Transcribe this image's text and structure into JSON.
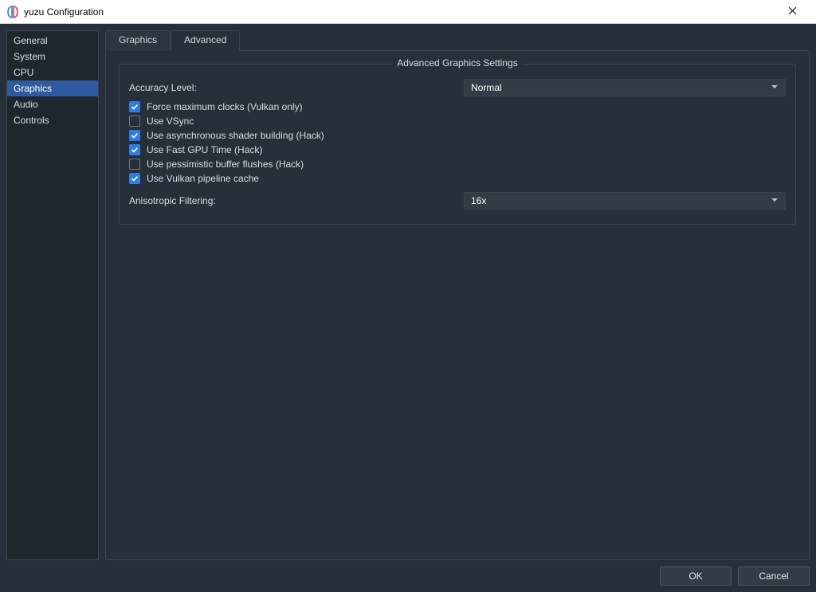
{
  "window": {
    "title": "yuzu Configuration"
  },
  "sidebar": {
    "items": [
      {
        "label": "General"
      },
      {
        "label": "System"
      },
      {
        "label": "CPU"
      },
      {
        "label": "Graphics"
      },
      {
        "label": "Audio"
      },
      {
        "label": "Controls"
      }
    ],
    "active_index": 3
  },
  "tabs": {
    "items": [
      {
        "label": "Graphics"
      },
      {
        "label": "Advanced"
      }
    ],
    "active_index": 1
  },
  "group": {
    "title": "Advanced Graphics Settings",
    "accuracy": {
      "label": "Accuracy Level:",
      "value": "Normal"
    },
    "checks": [
      {
        "label": "Force maximum clocks (Vulkan only)",
        "checked": true
      },
      {
        "label": "Use VSync",
        "checked": false
      },
      {
        "label": "Use asynchronous shader building (Hack)",
        "checked": true
      },
      {
        "label": "Use Fast GPU Time (Hack)",
        "checked": true
      },
      {
        "label": "Use pessimistic buffer flushes (Hack)",
        "checked": false
      },
      {
        "label": "Use Vulkan pipeline cache",
        "checked": true
      }
    ],
    "aniso": {
      "label": "Anisotropic Filtering:",
      "value": "16x"
    }
  },
  "buttons": {
    "ok": "OK",
    "cancel": "Cancel"
  }
}
